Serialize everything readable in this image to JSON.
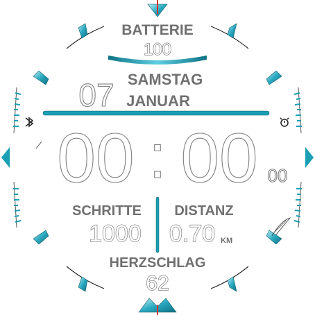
{
  "battery": {
    "label": "BATTERIE",
    "value": "100"
  },
  "date": {
    "day": "07",
    "weekday": "SAMSTAG",
    "month": "JANUAR"
  },
  "time": {
    "hours": "00",
    "separator": ":",
    "minutes": "00",
    "seconds": "00"
  },
  "steps": {
    "label": "SCHRITTE",
    "value": "1000"
  },
  "distance": {
    "label": "DISTANZ",
    "value": "0.70",
    "unit": "KM"
  },
  "heart_rate": {
    "label": "HERZSCHLAG",
    "value": "62"
  },
  "icons": {
    "left": "bluetooth-icon",
    "right": "alarm-clock-icon"
  },
  "colors": {
    "accent": "#1a9fb4",
    "accent_light": "#7fd6e6",
    "text": "#707070",
    "marker_red": "#d9342b",
    "background": "#ffffff"
  }
}
